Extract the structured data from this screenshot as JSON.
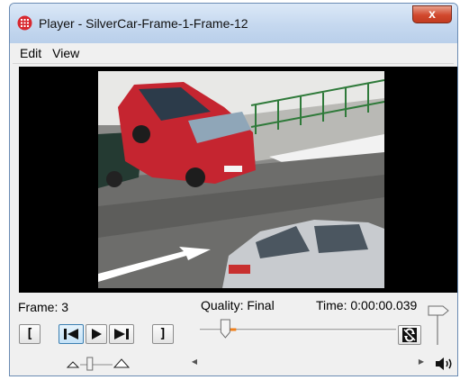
{
  "window": {
    "title": "Player - SilverCar-Frame-1-Frame-12",
    "close_label": "x"
  },
  "menu": {
    "items": [
      "Edit",
      "View"
    ]
  },
  "status": {
    "frame_label": "Frame: 3",
    "quality_label": "Quality: Final",
    "time_label": "Time: 0:00:00.039"
  },
  "transport": {
    "mark_in_label": "[",
    "mark_out_label": "]"
  },
  "sliders": {
    "quality_level": 0.13,
    "speed_level": 0.3,
    "volume_level": 0.5
  },
  "colors": {
    "title_bar": "#c5d8ef",
    "close_button": "#d1482d",
    "video_background": "#000000",
    "active_button": "#c4e2f7",
    "slider_accent": "#f07f1a"
  },
  "icons": {
    "app": "player-app-icon",
    "loop": "loop-icon",
    "volume": "speaker-icon"
  }
}
